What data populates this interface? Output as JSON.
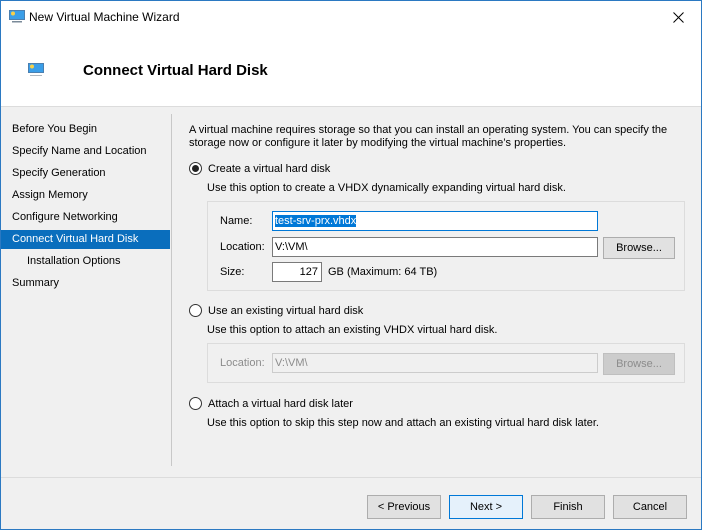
{
  "window": {
    "title": "New Virtual Machine Wizard",
    "app_icon": "monitor-icon",
    "close_icon": "close-icon"
  },
  "header": {
    "title": "Connect Virtual Hard Disk",
    "icon": "monitor-icon"
  },
  "sidebar": {
    "items": [
      {
        "label": "Before You Begin",
        "active": false,
        "sub": false
      },
      {
        "label": "Specify Name and Location",
        "active": false,
        "sub": false
      },
      {
        "label": "Specify Generation",
        "active": false,
        "sub": false
      },
      {
        "label": "Assign Memory",
        "active": false,
        "sub": false
      },
      {
        "label": "Configure Networking",
        "active": false,
        "sub": false
      },
      {
        "label": "Connect Virtual Hard Disk",
        "active": true,
        "sub": false
      },
      {
        "label": "Installation Options",
        "active": false,
        "sub": true
      },
      {
        "label": "Summary",
        "active": false,
        "sub": false
      }
    ]
  },
  "content": {
    "intro": "A virtual machine requires storage so that you can install an operating system. You can specify the storage now or configure it later by modifying the virtual machine’s properties.",
    "create": {
      "label": "Create a virtual hard disk",
      "selected": true,
      "description": "Use this option to create a VHDX dynamically expanding virtual hard disk.",
      "name_label": "Name:",
      "name_value": "test-srv-prx.vhdx",
      "location_label": "Location:",
      "location_value": "V:\\VM\\",
      "browse_label": "Browse...",
      "size_label": "Size:",
      "size_value": "127",
      "size_unit": "GB (Maximum: 64 TB)"
    },
    "existing": {
      "label": "Use an existing virtual hard disk",
      "selected": false,
      "description": "Use this option to attach an existing VHDX virtual hard disk.",
      "location_label": "Location:",
      "location_value": "V:\\VM\\",
      "browse_label": "Browse..."
    },
    "later": {
      "label": "Attach a virtual hard disk later",
      "selected": false,
      "description": "Use this option to skip this step now and attach an existing virtual hard disk later."
    }
  },
  "footer": {
    "previous": "< Previous",
    "next": "Next >",
    "finish": "Finish",
    "cancel": "Cancel"
  },
  "colors": {
    "accent": "#0a6ebd",
    "window_border": "#2b79c2"
  }
}
